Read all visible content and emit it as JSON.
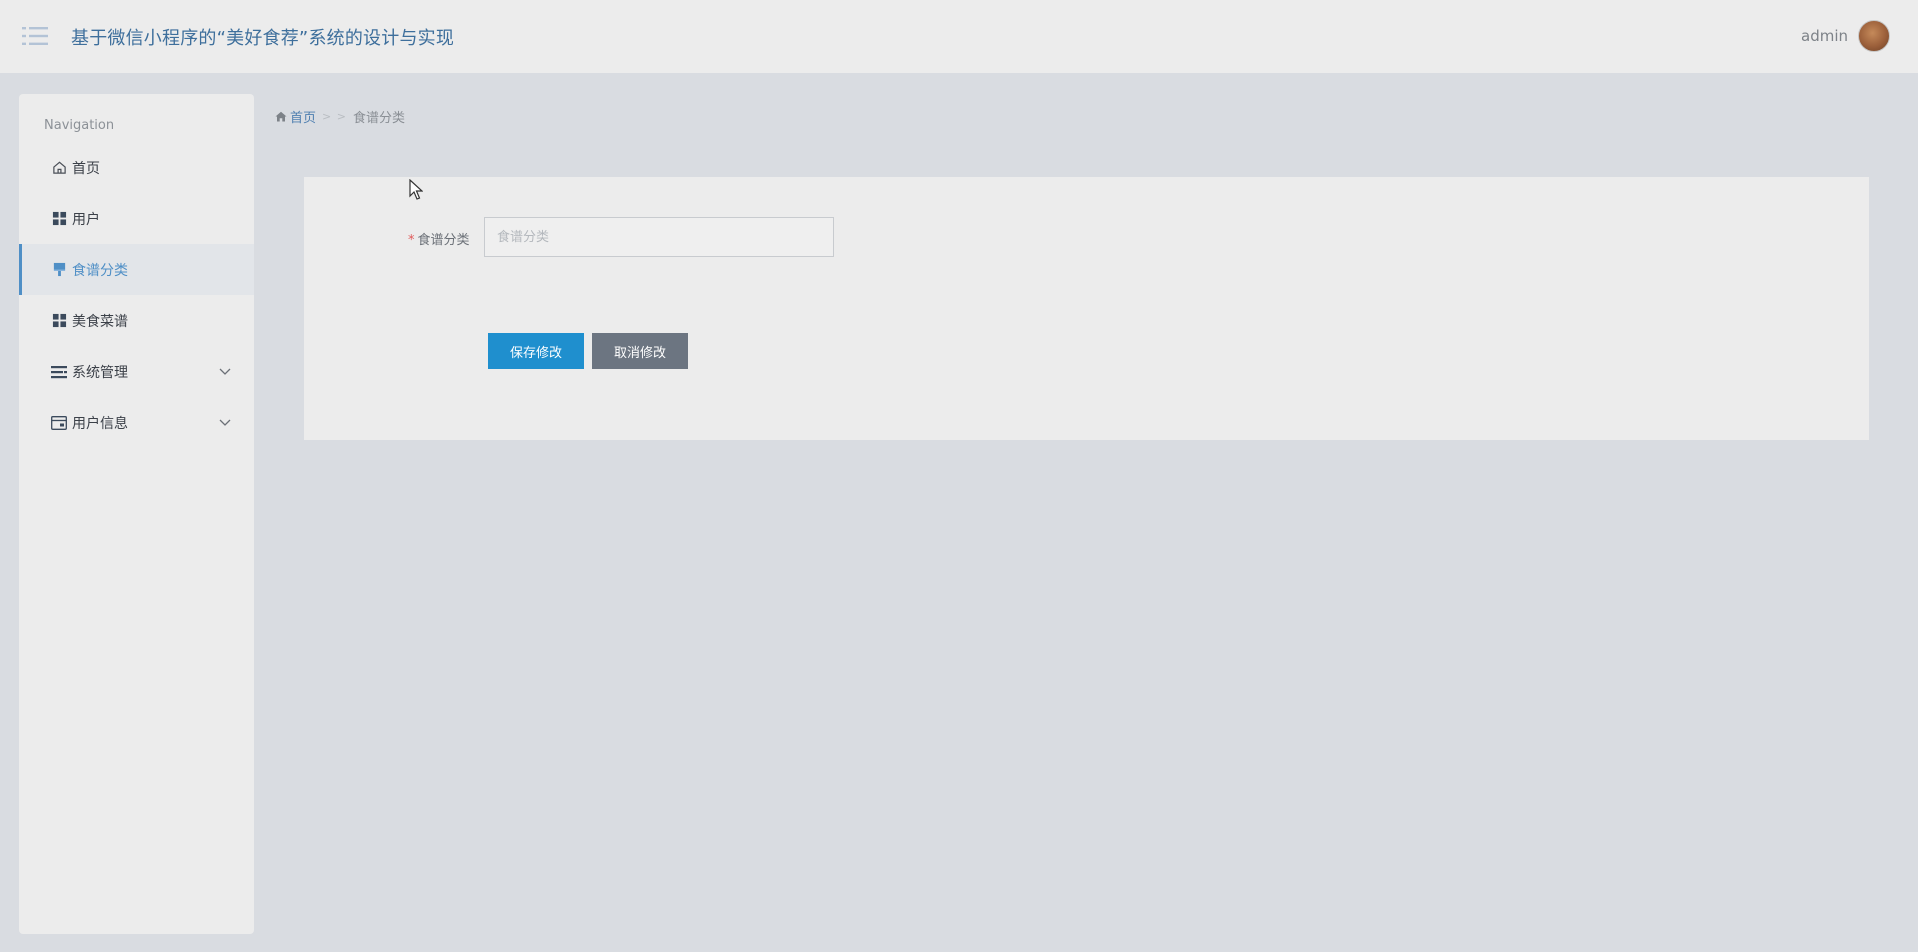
{
  "header": {
    "title": "基于微信小程序的“美好食荐”系统的设计与实现",
    "username": "admin",
    "menu_icon": "menu-list-icon"
  },
  "sidebar": {
    "heading": "Navigation",
    "items": [
      {
        "label": "首页",
        "icon": "home-icon",
        "active": false,
        "expandable": false
      },
      {
        "label": "用户",
        "icon": "grid-icon",
        "active": false,
        "expandable": false
      },
      {
        "label": "食谱分类",
        "icon": "brush-icon",
        "active": true,
        "expandable": false
      },
      {
        "label": "美食菜谱",
        "icon": "grid-icon",
        "active": false,
        "expandable": false
      },
      {
        "label": "系统管理",
        "icon": "list-bars-icon",
        "active": false,
        "expandable": true
      },
      {
        "label": "用户信息",
        "icon": "card-icon",
        "active": false,
        "expandable": true
      }
    ]
  },
  "breadcrumb": {
    "home": "首页",
    "separator": "> >",
    "current": "食谱分类"
  },
  "form": {
    "field_label": "食谱分类",
    "required_mark": "*",
    "field_value": "",
    "field_placeholder": "食谱分类",
    "save_label": "保存修改",
    "cancel_label": "取消修改"
  },
  "colors": {
    "accent": "#4f8fc6",
    "save_button": "#1f8fce",
    "cancel_button": "#6c7581",
    "title": "#3e6f9c"
  }
}
